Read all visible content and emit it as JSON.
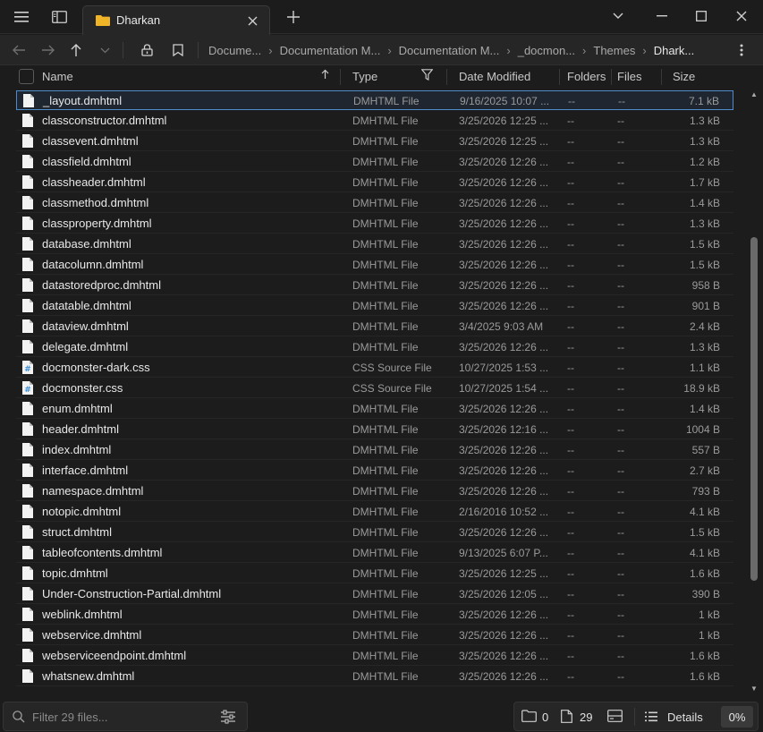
{
  "window": {
    "tab_title": "Dharkan",
    "controls": [
      "minimize",
      "maximize",
      "close"
    ]
  },
  "breadcrumb": [
    "Docume...",
    "Documentation M...",
    "Documentation M...",
    "_docmon...",
    "Themes",
    "Dhark..."
  ],
  "columns": {
    "name": "Name",
    "type": "Type",
    "date": "Date Modified",
    "folders": "Folders",
    "files": "Files",
    "size": "Size"
  },
  "files": [
    {
      "name": "_layout.dmhtml",
      "type": "DMHTML File",
      "date": "9/16/2025 10:07 ...",
      "folders": "--",
      "files": "--",
      "size": "7.1 kB",
      "icon": "html"
    },
    {
      "name": "classconstructor.dmhtml",
      "type": "DMHTML File",
      "date": "3/25/2026 12:25 ...",
      "folders": "--",
      "files": "--",
      "size": "1.3 kB",
      "icon": "html"
    },
    {
      "name": "classevent.dmhtml",
      "type": "DMHTML File",
      "date": "3/25/2026 12:25 ...",
      "folders": "--",
      "files": "--",
      "size": "1.3 kB",
      "icon": "html"
    },
    {
      "name": "classfield.dmhtml",
      "type": "DMHTML File",
      "date": "3/25/2026 12:26 ...",
      "folders": "--",
      "files": "--",
      "size": "1.2 kB",
      "icon": "html"
    },
    {
      "name": "classheader.dmhtml",
      "type": "DMHTML File",
      "date": "3/25/2026 12:26 ...",
      "folders": "--",
      "files": "--",
      "size": "1.7 kB",
      "icon": "html"
    },
    {
      "name": "classmethod.dmhtml",
      "type": "DMHTML File",
      "date": "3/25/2026 12:26 ...",
      "folders": "--",
      "files": "--",
      "size": "1.4 kB",
      "icon": "html"
    },
    {
      "name": "classproperty.dmhtml",
      "type": "DMHTML File",
      "date": "3/25/2026 12:26 ...",
      "folders": "--",
      "files": "--",
      "size": "1.3 kB",
      "icon": "html"
    },
    {
      "name": "database.dmhtml",
      "type": "DMHTML File",
      "date": "3/25/2026 12:26 ...",
      "folders": "--",
      "files": "--",
      "size": "1.5 kB",
      "icon": "html"
    },
    {
      "name": "datacolumn.dmhtml",
      "type": "DMHTML File",
      "date": "3/25/2026 12:26 ...",
      "folders": "--",
      "files": "--",
      "size": "1.5 kB",
      "icon": "html"
    },
    {
      "name": "datastoredproc.dmhtml",
      "type": "DMHTML File",
      "date": "3/25/2026 12:26 ...",
      "folders": "--",
      "files": "--",
      "size": "958 B",
      "icon": "html"
    },
    {
      "name": "datatable.dmhtml",
      "type": "DMHTML File",
      "date": "3/25/2026 12:26 ...",
      "folders": "--",
      "files": "--",
      "size": "901 B",
      "icon": "html"
    },
    {
      "name": "dataview.dmhtml",
      "type": "DMHTML File",
      "date": "3/4/2025 9:03 AM",
      "folders": "--",
      "files": "--",
      "size": "2.4 kB",
      "icon": "html"
    },
    {
      "name": "delegate.dmhtml",
      "type": "DMHTML File",
      "date": "3/25/2026 12:26 ...",
      "folders": "--",
      "files": "--",
      "size": "1.3 kB",
      "icon": "html"
    },
    {
      "name": "docmonster-dark.css",
      "type": "CSS Source File",
      "date": "10/27/2025 1:53 ...",
      "folders": "--",
      "files": "--",
      "size": "1.1 kB",
      "icon": "css"
    },
    {
      "name": "docmonster.css",
      "type": "CSS Source File",
      "date": "10/27/2025 1:54 ...",
      "folders": "--",
      "files": "--",
      "size": "18.9 kB",
      "icon": "css"
    },
    {
      "name": "enum.dmhtml",
      "type": "DMHTML File",
      "date": "3/25/2026 12:26 ...",
      "folders": "--",
      "files": "--",
      "size": "1.4 kB",
      "icon": "html"
    },
    {
      "name": "header.dmhtml",
      "type": "DMHTML File",
      "date": "3/25/2026 12:16 ...",
      "folders": "--",
      "files": "--",
      "size": "1004 B",
      "icon": "html"
    },
    {
      "name": "index.dmhtml",
      "type": "DMHTML File",
      "date": "3/25/2026 12:26 ...",
      "folders": "--",
      "files": "--",
      "size": "557 B",
      "icon": "html"
    },
    {
      "name": "interface.dmhtml",
      "type": "DMHTML File",
      "date": "3/25/2026 12:26 ...",
      "folders": "--",
      "files": "--",
      "size": "2.7 kB",
      "icon": "html"
    },
    {
      "name": "namespace.dmhtml",
      "type": "DMHTML File",
      "date": "3/25/2026 12:26 ...",
      "folders": "--",
      "files": "--",
      "size": "793 B",
      "icon": "html"
    },
    {
      "name": "notopic.dmhtml",
      "type": "DMHTML File",
      "date": "2/16/2016 10:52 ...",
      "folders": "--",
      "files": "--",
      "size": "4.1 kB",
      "icon": "html"
    },
    {
      "name": "struct.dmhtml",
      "type": "DMHTML File",
      "date": "3/25/2026 12:26 ...",
      "folders": "--",
      "files": "--",
      "size": "1.5 kB",
      "icon": "html"
    },
    {
      "name": "tableofcontents.dmhtml",
      "type": "DMHTML File",
      "date": "9/13/2025 6:07 P...",
      "folders": "--",
      "files": "--",
      "size": "4.1 kB",
      "icon": "html"
    },
    {
      "name": "topic.dmhtml",
      "type": "DMHTML File",
      "date": "3/25/2026 12:25 ...",
      "folders": "--",
      "files": "--",
      "size": "1.6 kB",
      "icon": "html"
    },
    {
      "name": "Under-Construction-Partial.dmhtml",
      "type": "DMHTML File",
      "date": "3/25/2026 12:05 ...",
      "folders": "--",
      "files": "--",
      "size": "390 B",
      "icon": "html"
    },
    {
      "name": "weblink.dmhtml",
      "type": "DMHTML File",
      "date": "3/25/2026 12:26 ...",
      "folders": "--",
      "files": "--",
      "size": "1 kB",
      "icon": "html"
    },
    {
      "name": "webservice.dmhtml",
      "type": "DMHTML File",
      "date": "3/25/2026 12:26 ...",
      "folders": "--",
      "files": "--",
      "size": "1 kB",
      "icon": "html"
    },
    {
      "name": "webserviceendpoint.dmhtml",
      "type": "DMHTML File",
      "date": "3/25/2026 12:26 ...",
      "folders": "--",
      "files": "--",
      "size": "1.6 kB",
      "icon": "html"
    },
    {
      "name": "whatsnew.dmhtml",
      "type": "DMHTML File",
      "date": "3/25/2026 12:26 ...",
      "folders": "--",
      "files": "--",
      "size": "1.6 kB",
      "icon": "html"
    }
  ],
  "selected_index": 0,
  "filter": {
    "placeholder": "Filter 29 files..."
  },
  "status": {
    "folder_count": "0",
    "file_count": "29",
    "details_label": "Details",
    "percent": "0%"
  },
  "colors": {
    "background": "#1c1c1c",
    "accent": "#4f8cc9",
    "folder_icon": "#f0b429",
    "css_icon": "#3b8fd6"
  }
}
